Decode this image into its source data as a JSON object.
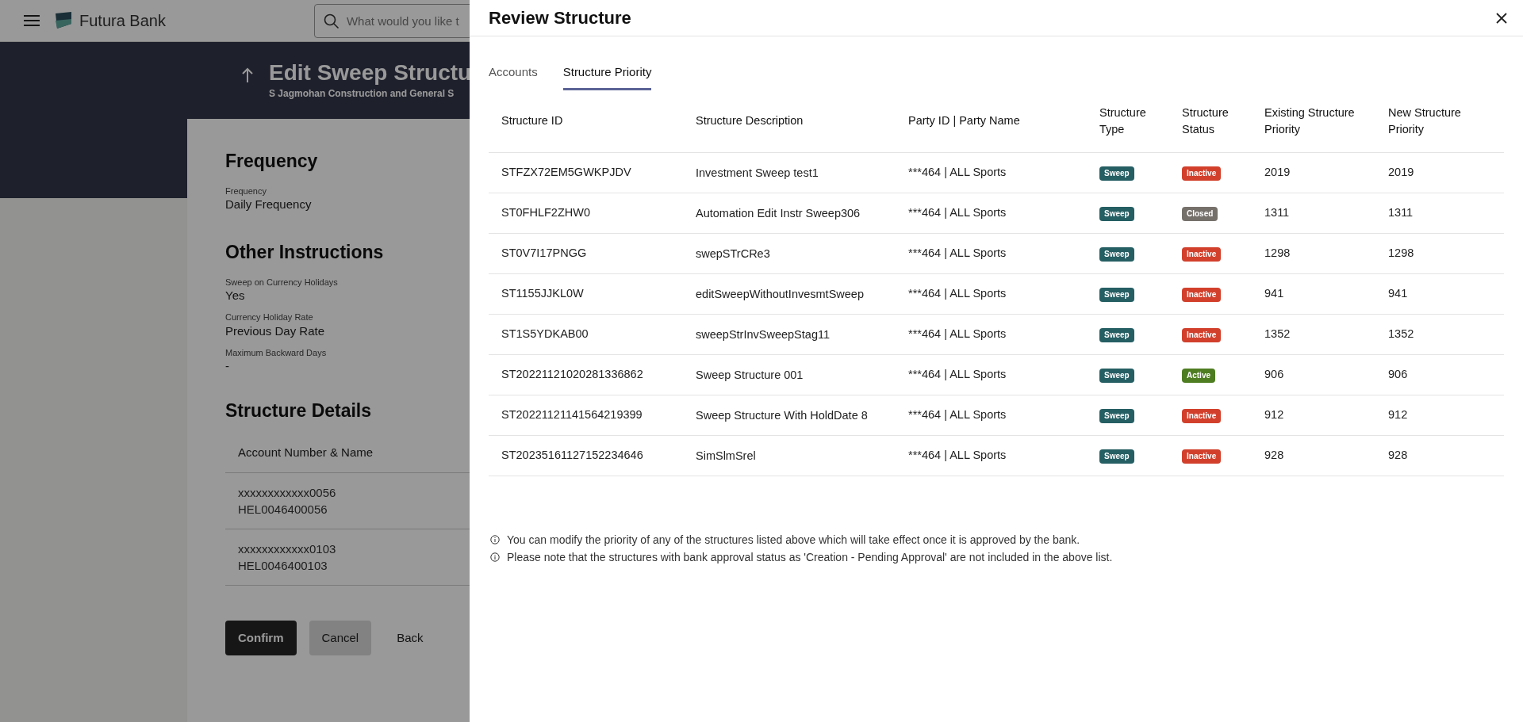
{
  "header": {
    "brand": "Futura Bank",
    "search": {
      "placeholder": "What would you like t"
    }
  },
  "banner": {
    "title": "Edit Sweep Structu",
    "subtitle": "S Jagmohan Construction and General S"
  },
  "page": {
    "sections": [
      {
        "title": "Frequency",
        "fields": [
          {
            "label": "Frequency",
            "value": "Daily Frequency"
          }
        ]
      },
      {
        "title": "Other Instructions",
        "fields": [
          {
            "label": "Sweep on Currency Holidays",
            "value": "Yes"
          },
          {
            "label": "Currency Holiday Rate",
            "value": "Previous Day Rate"
          },
          {
            "label": "Maximum Backward Days",
            "value": "-"
          }
        ]
      }
    ],
    "structure_details": {
      "title": "Structure Details",
      "column": "Account Number & Name",
      "rows": [
        {
          "account": "xxxxxxxxxxxx0056",
          "name": "HEL0046400056"
        },
        {
          "account": "xxxxxxxxxxxx0103",
          "name": "HEL0046400103"
        }
      ]
    },
    "buttons": [
      {
        "label": "Confirm",
        "kind": "primary"
      },
      {
        "label": "Cancel",
        "kind": "secondary"
      },
      {
        "label": "Back",
        "kind": "link"
      }
    ]
  },
  "modal": {
    "title": "Review Structure",
    "tabs": [
      {
        "label": "Accounts",
        "selected": false
      },
      {
        "label": "Structure Priority",
        "selected": true
      }
    ],
    "table": {
      "columns": [
        "Structure ID",
        "Structure Description",
        "Party ID | Party Name",
        "Structure Type",
        "Structure Status",
        "Existing Structure Priority",
        "New Structure Priority"
      ],
      "rows": [
        {
          "id": "STFZX72EM5GWKPJDV",
          "description": "Investment Sweep test1",
          "party": "***464 | ALL Sports",
          "type": "Sweep",
          "status": {
            "label": "Inactive",
            "color": "#d2402c"
          },
          "existing": "2019",
          "new": "2019"
        },
        {
          "id": "ST0FHLF2ZHW0",
          "description": "Automation Edit Instr Sweep306",
          "party": "***464 | ALL Sports",
          "type": "Sweep",
          "status": {
            "label": "Closed",
            "color": "#76706b"
          },
          "existing": "1311",
          "new": "1311"
        },
        {
          "id": "ST0V7I17PNGG",
          "description": "swepSTrCRe3",
          "party": "***464 | ALL Sports",
          "type": "Sweep",
          "status": {
            "label": "Inactive",
            "color": "#d2402c"
          },
          "existing": "1298",
          "new": "1298"
        },
        {
          "id": "ST1155JJKL0W",
          "description": "editSweepWithoutInvesmtSweep",
          "party": "***464 | ALL Sports",
          "type": "Sweep",
          "status": {
            "label": "Inactive",
            "color": "#d2402c"
          },
          "existing": "941",
          "new": "941"
        },
        {
          "id": "ST1S5YDKAB00",
          "description": "sweepStrInvSweepStag11",
          "party": "***464 | ALL Sports",
          "type": "Sweep",
          "status": {
            "label": "Inactive",
            "color": "#d2402c"
          },
          "existing": "1352",
          "new": "1352"
        },
        {
          "id": "ST20221121020281336862",
          "description": "Sweep Structure 001",
          "party": "***464 | ALL Sports",
          "type": "Sweep",
          "status": {
            "label": "Active",
            "color": "#4e7d21"
          },
          "existing": "906",
          "new": "906"
        },
        {
          "id": "ST20221121141564219399",
          "description": "Sweep Structure With HoldDate 8",
          "party": "***464 | ALL Sports",
          "type": "Sweep",
          "status": {
            "label": "Inactive",
            "color": "#d2402c"
          },
          "existing": "912",
          "new": "912"
        },
        {
          "id": "ST20235161127152234646",
          "description": "SimSlmSrel",
          "party": "***464 | ALL Sports",
          "type": "Sweep",
          "status": {
            "label": "Inactive",
            "color": "#d2402c"
          },
          "existing": "928",
          "new": "928"
        }
      ]
    },
    "notes": [
      "You can modify the priority of any of the structures listed above which will take effect once it is approved by the bank.",
      "Please note that the structures with bank approval status as 'Creation - Pending Approval' are not included in the above list."
    ]
  }
}
